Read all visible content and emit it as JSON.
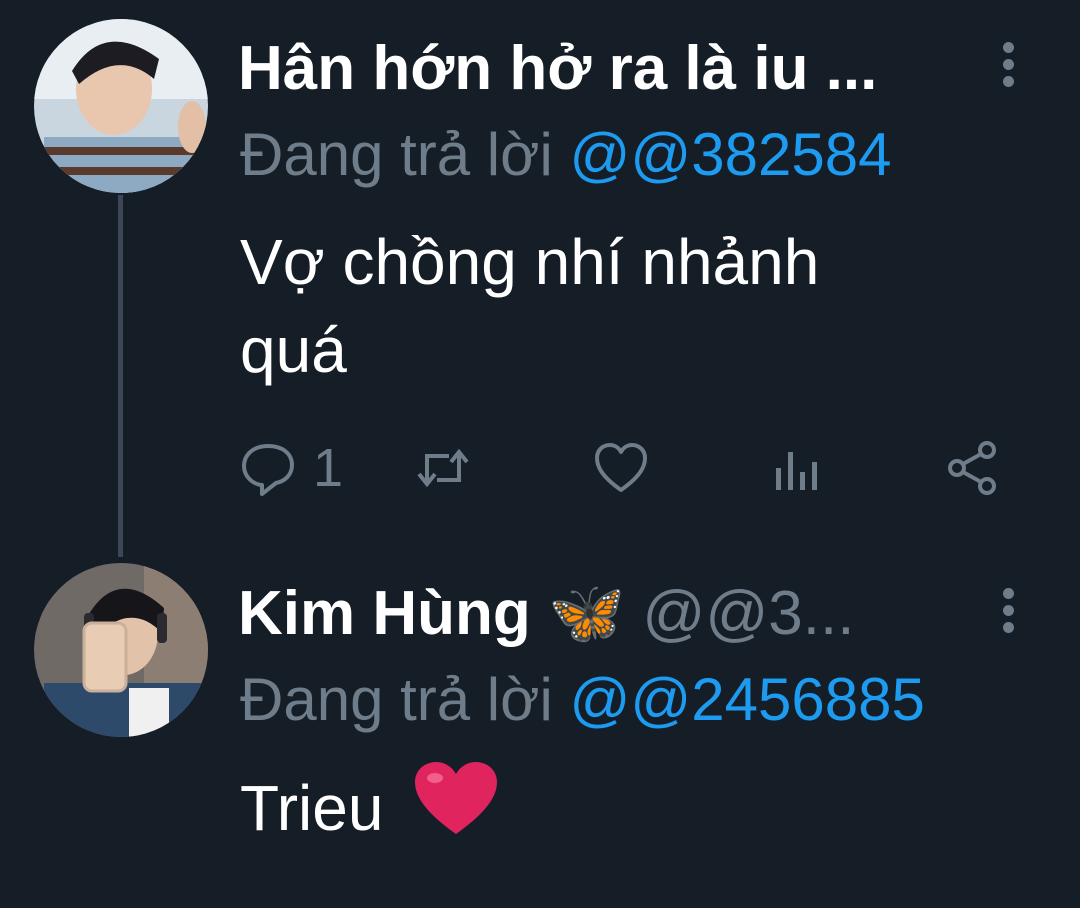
{
  "tweets": [
    {
      "author": "Hân hớn hở ra là iu ...",
      "handle": "",
      "replying_label": "Đang trả lời",
      "replying_to": "@@382584",
      "text_line1": "Vợ chồng nhí nhảnh",
      "text_line2": "quá",
      "reply_count": "1"
    },
    {
      "author": "Kim Hùng",
      "emoji": "🦋",
      "handle": "@@3...",
      "replying_label": "Đang trả lời",
      "replying_to": "@@2456885",
      "text": "Trieu"
    }
  ],
  "icons": [
    "reply-icon",
    "retweet-icon",
    "like-icon",
    "views-icon",
    "share-icon",
    "more-icon",
    "butterfly-emoji",
    "heart-emoji"
  ],
  "colors": {
    "background": "#151d27",
    "muted": "#6f7c89",
    "mention": "#1d9bf0",
    "heart": "#e0245e"
  }
}
